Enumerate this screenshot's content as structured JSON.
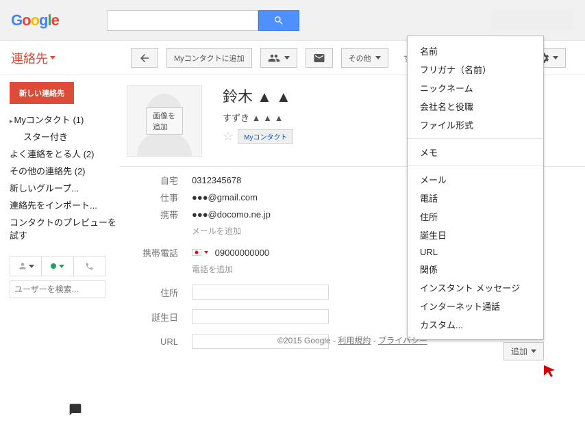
{
  "header": {
    "search_placeholder": ""
  },
  "toolbar": {
    "app_name": "連絡先",
    "add_to": "Myコンタクトに追加",
    "other": "その他",
    "save_now": "すぐに保存"
  },
  "sidebar": {
    "new_contact": "新しい連絡先",
    "items": [
      "Myコンタクト  (1)",
      "スター付き",
      "よく連絡をとる人  (2)",
      "その他の連絡先 (2)",
      "新しいグループ...",
      "連絡先をインポート...",
      "コンタクトのプレビューを試す"
    ],
    "search_placeholder": "ユーザーを検索..."
  },
  "contact": {
    "add_image": "画像を追加",
    "name": "鈴木 ▲ ▲",
    "furigana": "すずき  ▲ ▲ ▲",
    "tag": "Myコンタクト",
    "labels": {
      "home": "自宅",
      "work": "仕事",
      "mobile": "携帯",
      "add_email": "メールを追加",
      "mobile_phone": "携帯電話",
      "add_phone": "電話を追加",
      "address": "住所",
      "birthday": "誕生日",
      "url": "URL"
    },
    "values": {
      "home": "0312345678",
      "work": "●●●@gmail.com",
      "mobile": "●●●@docomo.ne.jp",
      "mobile_phone": "09000000000"
    }
  },
  "add_menu": {
    "button": "追加",
    "sect1": [
      "名前",
      "フリガナ（名前）",
      "ニックネーム",
      "会社名と役職",
      "ファイル形式"
    ],
    "sect2": [
      "メモ"
    ],
    "sect3": [
      "メール",
      "電話",
      "住所",
      "誕生日",
      "URL",
      "関係",
      "インスタント メッセージ",
      "インターネット通話",
      "カスタム..."
    ]
  },
  "footer": {
    "copyright": "©2015 Google",
    "terms": "利用規約",
    "privacy": "プライバシー"
  }
}
